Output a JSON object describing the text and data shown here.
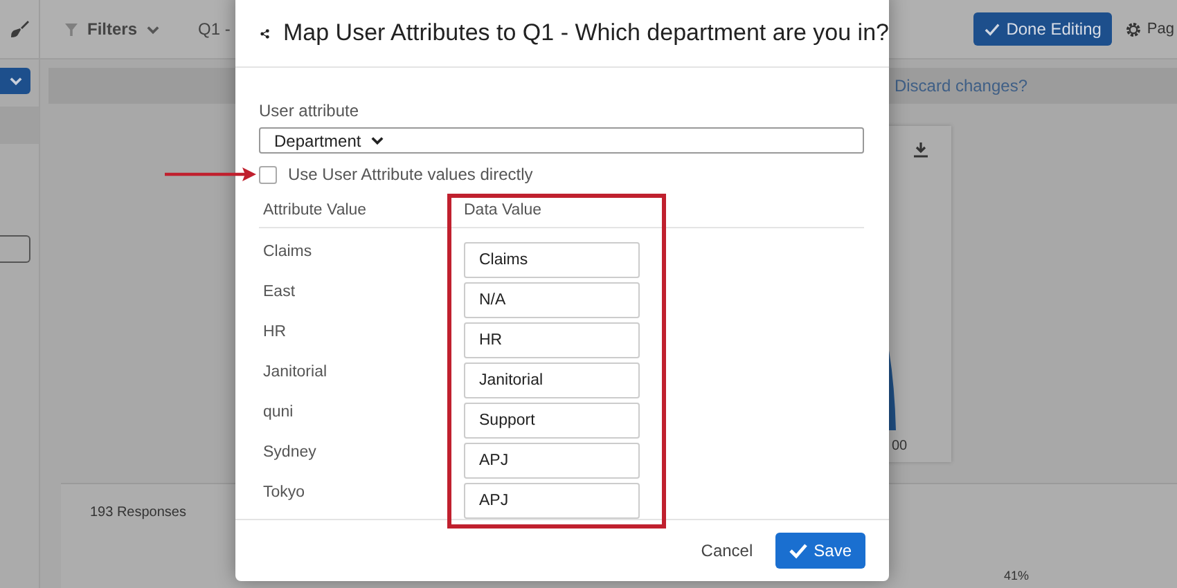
{
  "toolbar": {
    "filters_label": "Filters",
    "question_tab": "Q1 -",
    "done_button": "Done Editing",
    "page_button": "Pag"
  },
  "notice_bar": {
    "link": "Discard changes?"
  },
  "chart_card": {
    "axis_text": "00"
  },
  "responses_card": {
    "count": "193 Responses",
    "percent_label": "41%"
  },
  "dialog": {
    "title": "Map User Attributes to Q1 - Which department are you in?",
    "user_attribute": {
      "label": "User attribute",
      "value": "Department"
    },
    "use_values_directly": {
      "label": "Use User Attribute values directly",
      "checked": false
    },
    "columns": [
      "Attribute Value",
      "Data Value"
    ],
    "rows": [
      {
        "attribute": "Claims",
        "value": "Claims"
      },
      {
        "attribute": "East",
        "value": "N/A"
      },
      {
        "attribute": "HR",
        "value": "HR"
      },
      {
        "attribute": "Janitorial",
        "value": "Janitorial"
      },
      {
        "attribute": "quni",
        "value": "Support"
      },
      {
        "attribute": "Sydney",
        "value": "APJ"
      },
      {
        "attribute": "Tokyo",
        "value": "APJ"
      }
    ],
    "buttons": {
      "cancel": "Cancel",
      "save": "Save"
    }
  }
}
